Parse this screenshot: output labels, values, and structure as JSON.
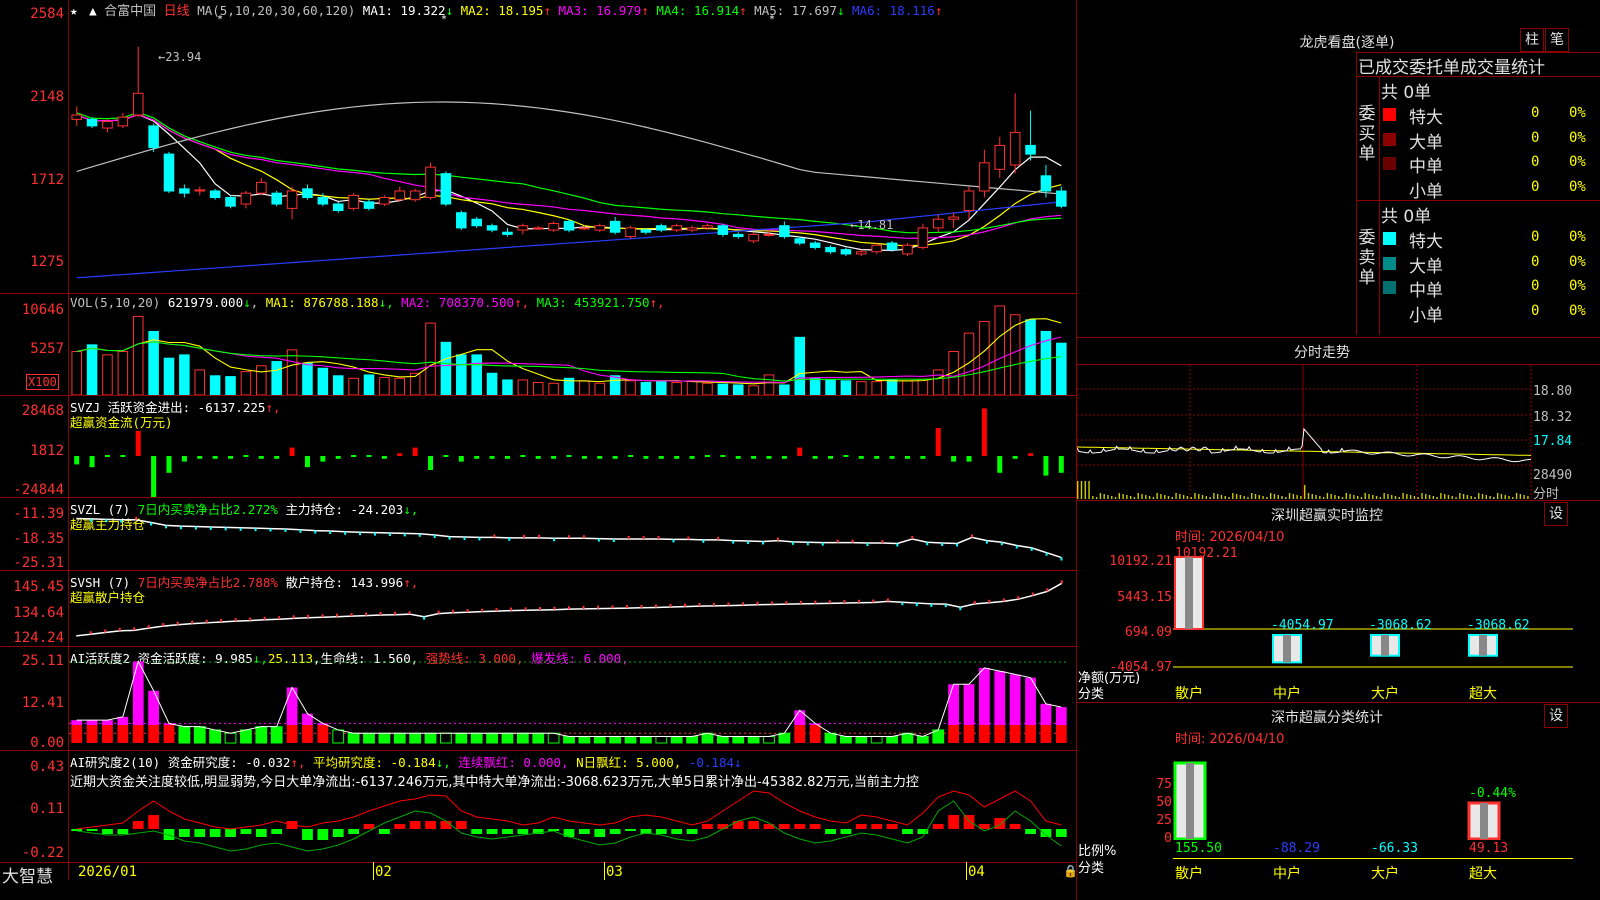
{
  "stock": {
    "name": "合富中国",
    "period": "日线",
    "logo": "大智慧"
  },
  "kline": {
    "axis": [
      "2584",
      "2148",
      "1712",
      "1275"
    ],
    "header": {
      "ma_label": "MA(5,10,20,30,60,120)",
      "ma": [
        {
          "label": "MA1: 19.322",
          "arrow": "↓",
          "color": "#ffffff"
        },
        {
          "label": "MA2: 18.195",
          "arrow": "↑",
          "color": "#ffff00"
        },
        {
          "label": "MA3: 16.979",
          "arrow": "↑",
          "color": "#ff00ff"
        },
        {
          "label": "MA4: 16.914",
          "arrow": "↑",
          "color": "#00ff00"
        },
        {
          "label": "MA5: 17.697",
          "arrow": "↓",
          "color": "#c0c0c0"
        },
        {
          "label": "MA6: 18.116",
          "arrow": "↑",
          "color": "#2a3dff"
        }
      ]
    },
    "high_mark": "23.94",
    "low_mark": "14.81",
    "candles": [
      {
        "o": 20.6,
        "c": 20.8,
        "h": 21.2,
        "l": 20.3
      },
      {
        "o": 20.6,
        "c": 20.3,
        "h": 20.7,
        "l": 20.2
      },
      {
        "o": 20.2,
        "c": 20.5,
        "h": 20.6,
        "l": 20.0
      },
      {
        "o": 20.3,
        "c": 20.7,
        "h": 20.9,
        "l": 20.2
      },
      {
        "o": 20.8,
        "c": 21.8,
        "h": 23.94,
        "l": 20.7
      },
      {
        "o": 20.3,
        "c": 19.3,
        "h": 20.4,
        "l": 19.1
      },
      {
        "o": 19.0,
        "c": 17.3,
        "h": 19.1,
        "l": 17.2
      },
      {
        "o": 17.4,
        "c": 17.2,
        "h": 17.6,
        "l": 17.0
      },
      {
        "o": 17.3,
        "c": 17.35,
        "h": 17.5,
        "l": 17.1
      },
      {
        "o": 17.3,
        "c": 17.0,
        "h": 17.4,
        "l": 16.9
      },
      {
        "o": 17.0,
        "c": 16.6,
        "h": 17.1,
        "l": 16.5
      },
      {
        "o": 16.7,
        "c": 17.2,
        "h": 17.3,
        "l": 16.5
      },
      {
        "o": 17.2,
        "c": 17.7,
        "h": 17.9,
        "l": 17.1
      },
      {
        "o": 17.2,
        "c": 16.7,
        "h": 17.3,
        "l": 16.6
      },
      {
        "o": 16.5,
        "c": 17.3,
        "h": 17.5,
        "l": 16.0
      },
      {
        "o": 17.4,
        "c": 17.0,
        "h": 17.6,
        "l": 16.9
      },
      {
        "o": 17.0,
        "c": 16.7,
        "h": 17.2,
        "l": 16.6
      },
      {
        "o": 16.7,
        "c": 16.4,
        "h": 16.8,
        "l": 16.3
      },
      {
        "o": 16.5,
        "c": 17.1,
        "h": 17.2,
        "l": 16.4
      },
      {
        "o": 16.8,
        "c": 16.5,
        "h": 16.9,
        "l": 16.4
      },
      {
        "o": 16.7,
        "c": 17.0,
        "h": 17.1,
        "l": 16.6
      },
      {
        "o": 16.9,
        "c": 17.3,
        "h": 17.5,
        "l": 16.8
      },
      {
        "o": 16.9,
        "c": 17.3,
        "h": 17.4,
        "l": 16.8
      },
      {
        "o": 17.0,
        "c": 18.4,
        "h": 18.6,
        "l": 16.9
      },
      {
        "o": 18.1,
        "c": 16.7,
        "h": 18.2,
        "l": 16.6
      },
      {
        "o": 16.3,
        "c": 15.6,
        "h": 16.4,
        "l": 15.5
      },
      {
        "o": 16.0,
        "c": 15.7,
        "h": 16.1,
        "l": 15.6
      },
      {
        "o": 15.7,
        "c": 15.5,
        "h": 15.8,
        "l": 15.4
      },
      {
        "o": 15.4,
        "c": 15.3,
        "h": 15.6,
        "l": 15.2
      },
      {
        "o": 15.5,
        "c": 15.7,
        "h": 15.8,
        "l": 15.3
      },
      {
        "o": 15.6,
        "c": 15.6,
        "h": 15.7,
        "l": 15.5
      },
      {
        "o": 15.5,
        "c": 15.8,
        "h": 15.9,
        "l": 15.4
      },
      {
        "o": 15.9,
        "c": 15.5,
        "h": 16.0,
        "l": 15.4
      },
      {
        "o": 15.6,
        "c": 15.6,
        "h": 15.7,
        "l": 15.5
      },
      {
        "o": 15.5,
        "c": 15.7,
        "h": 15.8,
        "l": 15.4
      },
      {
        "o": 15.9,
        "c": 15.4,
        "h": 16.1,
        "l": 15.3
      },
      {
        "o": 15.2,
        "c": 15.6,
        "h": 15.7,
        "l": 15.1
      },
      {
        "o": 15.5,
        "c": 15.4,
        "h": 15.6,
        "l": 15.3
      },
      {
        "o": 15.7,
        "c": 15.5,
        "h": 15.8,
        "l": 15.4
      },
      {
        "o": 15.5,
        "c": 15.7,
        "h": 15.8,
        "l": 15.4
      },
      {
        "o": 15.5,
        "c": 15.6,
        "h": 15.7,
        "l": 15.4
      },
      {
        "o": 15.6,
        "c": 15.7,
        "h": 15.8,
        "l": 15.5
      },
      {
        "o": 15.7,
        "c": 15.3,
        "h": 15.8,
        "l": 15.2
      },
      {
        "o": 15.3,
        "c": 15.2,
        "h": 15.4,
        "l": 15.1
      },
      {
        "o": 15.0,
        "c": 15.3,
        "h": 15.4,
        "l": 14.9
      },
      {
        "o": 15.3,
        "c": 15.3,
        "h": 15.5,
        "l": 15.2
      },
      {
        "o": 15.7,
        "c": 15.2,
        "h": 15.9,
        "l": 15.1
      },
      {
        "o": 15.1,
        "c": 14.9,
        "h": 15.2,
        "l": 14.8
      },
      {
        "o": 14.9,
        "c": 14.7,
        "h": 15.0,
        "l": 14.6
      },
      {
        "o": 14.7,
        "c": 14.5,
        "h": 14.8,
        "l": 14.4
      },
      {
        "o": 14.6,
        "c": 14.4,
        "h": 14.7,
        "l": 14.3
      },
      {
        "o": 14.4,
        "c": 14.5,
        "h": 14.6,
        "l": 14.3
      },
      {
        "o": 14.5,
        "c": 14.8,
        "h": 14.9,
        "l": 14.4
      },
      {
        "o": 14.9,
        "c": 14.6,
        "h": 15.0,
        "l": 14.5
      },
      {
        "o": 14.4,
        "c": 14.8,
        "h": 14.9,
        "l": 14.3
      },
      {
        "o": 14.7,
        "c": 15.6,
        "h": 15.8,
        "l": 14.6
      },
      {
        "o": 15.6,
        "c": 16.0,
        "h": 16.2,
        "l": 15.4
      },
      {
        "o": 16.0,
        "c": 16.1,
        "h": 16.3,
        "l": 15.6
      },
      {
        "o": 16.4,
        "c": 17.3,
        "h": 17.5,
        "l": 16.0
      },
      {
        "o": 17.3,
        "c": 18.6,
        "h": 19.2,
        "l": 17.0
      },
      {
        "o": 18.3,
        "c": 19.4,
        "h": 19.8,
        "l": 17.9
      },
      {
        "o": 18.5,
        "c": 20.0,
        "h": 21.8,
        "l": 18.1
      },
      {
        "o": 19.4,
        "c": 19.0,
        "h": 21.0,
        "l": 18.7
      },
      {
        "o": 18.0,
        "c": 17.3,
        "h": 18.5,
        "l": 17.0
      },
      {
        "o": 17.3,
        "c": 16.6,
        "h": 17.5,
        "l": 16.5
      }
    ]
  },
  "vol": {
    "header_label": "VOL(5,10,20)",
    "header_value": "621979.000",
    "header_arrow": "↓",
    "ma": [
      {
        "label": "MA1: 876788.188",
        "arrow": "↓",
        "color": "#ffff00"
      },
      {
        "label": "MA2: 708370.500",
        "arrow": "↑",
        "color": "#ff00ff"
      },
      {
        "label": "MA3: 453921.750",
        "arrow": "↑",
        "color": "#00ff00"
      }
    ],
    "axis": [
      "10646",
      "5257"
    ],
    "unit": "X100",
    "values": [
      5200,
      6000,
      4800,
      5200,
      9400,
      7600,
      4400,
      4800,
      3000,
      2300,
      2200,
      2800,
      3500,
      4000,
      5400,
      3800,
      3200,
      2300,
      2000,
      2400,
      2100,
      2000,
      2600,
      8600,
      6300,
      4800,
      4800,
      2600,
      1800,
      1800,
      1500,
      1400,
      2000,
      1700,
      1400,
      2300,
      1700,
      1500,
      1600,
      1500,
      1700,
      1400,
      1300,
      1200,
      1100,
      2400,
      1200,
      6900,
      2000,
      1800,
      1700,
      1600,
      1600,
      1800,
      1700,
      1900,
      3000,
      5200,
      7400,
      8800,
      10646,
      9600,
      9000,
      7600,
      6200
    ]
  },
  "svzj": {
    "header": "SVZJ  活跃资金进出: -6137.225",
    "header_tail": "↑,",
    "sub": "超赢资金流(万元)",
    "axis": [
      "28468",
      "1812",
      "-24844"
    ],
    "values": [
      -3,
      -4,
      0,
      0,
      9,
      -22,
      -6,
      -2,
      -1,
      -1,
      -1,
      0,
      -1,
      -1,
      3,
      -4,
      -2,
      -1,
      0,
      0,
      -1,
      1,
      3,
      -5,
      0,
      -2,
      -1,
      -1,
      -1,
      0,
      -1,
      -1,
      0,
      -1,
      -1,
      -1,
      0,
      -1,
      -1,
      -1,
      -1,
      0,
      0,
      -1,
      -1,
      -1,
      -1,
      3,
      -1,
      -1,
      0,
      -1,
      -1,
      -1,
      -1,
      -1,
      10,
      -2,
      -2,
      17,
      -6,
      -1,
      1,
      -7,
      -6
    ]
  },
  "svzl": {
    "header_prefix": "SVZL (7) ",
    "header_green": "7日内买卖净占比2.272%",
    "header_main": " 主力持仓: -24.203",
    "header_arrow": "↓,",
    "sub": "超赢主力持仓",
    "axis": [
      "-11.39",
      "-18.35",
      "-25.31"
    ],
    "values": [
      -14.5,
      -14.6,
      -14.7,
      -14.8,
      -14.8,
      -15.5,
      -16.2,
      -16.4,
      -16.5,
      -16.6,
      -16.7,
      -16.8,
      -16.9,
      -17.0,
      -17.1,
      -17.3,
      -17.5,
      -17.6,
      -17.8,
      -17.9,
      -18.0,
      -18.1,
      -18.2,
      -18.3,
      -18.6,
      -19.0,
      -19.1,
      -19.2,
      -19.2,
      -19.3,
      -19.3,
      -19.3,
      -19.4,
      -19.4,
      -19.4,
      -19.5,
      -19.6,
      -19.6,
      -19.6,
      -19.6,
      -19.7,
      -19.7,
      -19.8,
      -19.8,
      -20.0,
      -20.1,
      -20.2,
      -20.0,
      -20.3,
      -20.4,
      -20.5,
      -20.5,
      -20.5,
      -20.6,
      -20.6,
      -20.7,
      -19.6,
      -20.4,
      -20.6,
      -20.7,
      -19.2,
      -20.0,
      -20.4,
      -21.2,
      -21.8,
      -23.0,
      -24.2
    ]
  },
  "svsh": {
    "header_prefix": "SVSH (7) ",
    "header_green": "7日内买卖净占比2.788%",
    "header_main": " 散户持仓: 143.996",
    "header_arrow": "↑,",
    "sub": "超赢散户持仓",
    "axis": [
      "145.45",
      "134.64",
      "124.24"
    ],
    "values": [
      125.0,
      125.6,
      126.2,
      126.8,
      127.0,
      127.8,
      128.5,
      129.0,
      129.4,
      129.7,
      130.0,
      130.3,
      130.5,
      130.8,
      131.0,
      131.3,
      131.5,
      131.7,
      131.9,
      132.1,
      132.3,
      132.5,
      132.6,
      132.8,
      131.9,
      133.0,
      133.3,
      133.5,
      133.7,
      133.9,
      134.1,
      134.2,
      134.3,
      134.4,
      134.6,
      134.7,
      134.8,
      134.9,
      135.0,
      135.1,
      135.2,
      135.4,
      135.5,
      135.7,
      135.8,
      135.9,
      136.0,
      136.2,
      136.3,
      136.4,
      136.5,
      136.6,
      136.7,
      136.8,
      136.9,
      137.0,
      137.4,
      137.1,
      136.8,
      136.5,
      136.4,
      135.3,
      136.5,
      136.9,
      137.4,
      138.2,
      139.5,
      141.0,
      143.9
    ]
  },
  "ai": {
    "header": "AI活跃度2 资金活跃度: 9.985",
    "h_arrow1": "↓,",
    "h_v2": "25.113",
    "h_life": ",生命线: 1.560,",
    "h_strong": "强势线: 3.000,",
    "h_burst": "爆发线: 6.000,",
    "axis": [
      "25.11",
      "12.41",
      "0.00"
    ],
    "values": [
      7,
      7,
      7,
      8,
      25,
      16,
      6,
      5,
      5,
      4,
      3,
      4,
      5,
      5,
      17,
      9,
      6,
      4,
      3,
      3,
      3,
      3,
      3,
      3,
      3,
      3,
      3,
      3,
      3,
      3,
      3,
      3,
      2,
      2,
      2,
      2,
      2,
      2,
      2,
      2,
      2,
      3,
      2,
      2,
      2,
      2,
      3,
      10,
      6,
      3,
      2,
      2,
      2,
      2,
      3,
      2,
      4,
      18,
      18,
      23,
      22,
      21,
      20,
      12,
      11
    ]
  },
  "research": {
    "header": "AI研究度2(10)  资金研究度: -0.032",
    "h_arrow1": "↑,",
    "h_avg": "平均研究度: -0.184",
    "h_arrow2": "↓,",
    "h_c1": "连续飘红: 0.000,",
    "h_c2": "N日飘红: 5.000,",
    "h_c3": "-0.184",
    "text": "近期大资金关注度较低,明显弱势,今日大单净流出:-6137.246万元,其中特大单净流出:-3068.623万元,大单5日累计净出-45382.82万元,当前主力控",
    "axis": [
      "0.43",
      "0.11",
      "-0.22"
    ]
  },
  "time_axis": [
    "2026/01",
    "02",
    "03",
    "04"
  ],
  "right": {
    "dragon_title": "龙虎看盘(逐单)",
    "btn1": "柱",
    "btn2": "笔",
    "stat_title": "已成交委托单成交量统计",
    "buy_label": "委买单",
    "sell_label": "委卖单",
    "buy_total": "共 0单",
    "sell_total": "共 0单",
    "buy_rows": [
      {
        "name": "特大",
        "count": "0",
        "pct": "0%",
        "color": "#ff0000"
      },
      {
        "name": "大单",
        "count": "0",
        "pct": "0%",
        "color": "#8b0000"
      },
      {
        "name": "中单",
        "count": "0",
        "pct": "0%",
        "color": "#6b0000"
      },
      {
        "name": "小单",
        "count": "0",
        "pct": "0%",
        "color": "#000000"
      }
    ],
    "sell_rows": [
      {
        "name": "特大",
        "count": "0",
        "pct": "0%",
        "color": "#00ffff"
      },
      {
        "name": "大单",
        "count": "0",
        "pct": "0%",
        "color": "#008b8b"
      },
      {
        "name": "中单",
        "count": "0",
        "pct": "0%",
        "color": "#007070"
      },
      {
        "name": "小单",
        "count": "0",
        "pct": "0%",
        "color": "#000000"
      }
    ],
    "intraday_title": "分时走势",
    "intraday_axis": [
      "18.80",
      "18.32",
      "17.84",
      "28490",
      "分时"
    ],
    "sz_title": "深圳超赢实时监控",
    "sz_time": "时间: 2026/04/10",
    "sz_setting": "设",
    "sz_axis": [
      "10192.21",
      "5443.15",
      "694.09",
      "-4054.97"
    ],
    "sz_ylabel": "净额(万元)",
    "sz_xlabel": "分类",
    "sz_top_label": "10192.21",
    "sz_cats": [
      "散户",
      "中户",
      "大户",
      "超大"
    ],
    "sz_values": [
      10192.21,
      -4054.97,
      -3068.62,
      -3068.62
    ],
    "sz_value_labels": [
      "-4054.97",
      "-3068.62",
      "-3068.62"
    ],
    "cls_title": "深市超赢分类统计",
    "cls_time": "时间: 2026/04/10",
    "cls_setting": "设",
    "cls_axis": [
      "75",
      "50",
      "25",
      "0"
    ],
    "cls_ylabel": "比例%",
    "cls_xlabel": "分类",
    "cls_cats": [
      "散户",
      "中户",
      "大户",
      "超大"
    ],
    "cls_values": [
      "155.50",
      "-88.29",
      "-66.33",
      "49.13"
    ],
    "cls_extra": "-0.44%"
  }
}
